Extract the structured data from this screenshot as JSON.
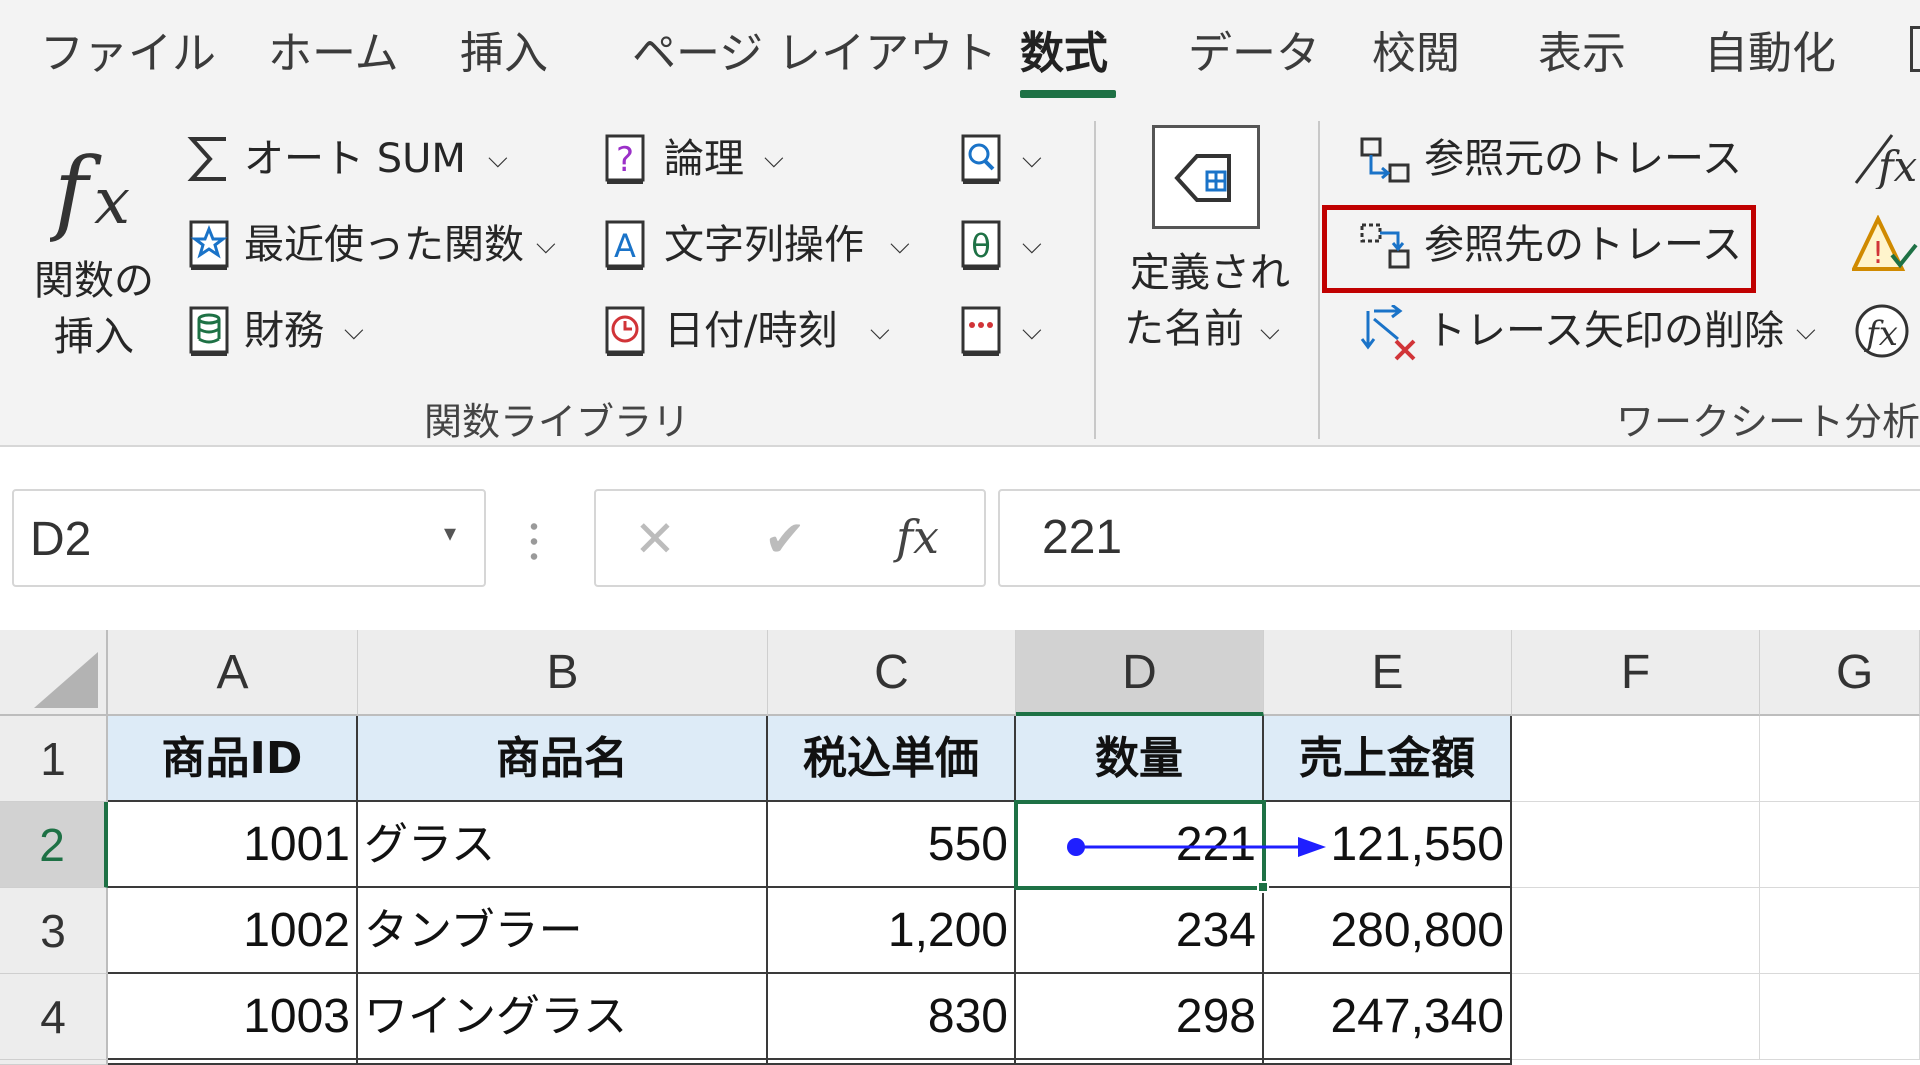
{
  "tabs": [
    {
      "label": "ファイル"
    },
    {
      "label": "ホーム"
    },
    {
      "label": "挿入"
    },
    {
      "label": "ページ レイアウト"
    },
    {
      "label": "数式"
    },
    {
      "label": "データ"
    },
    {
      "label": "校閲"
    },
    {
      "label": "表示"
    },
    {
      "label": "自動化"
    }
  ],
  "active_tab": "数式",
  "ribbon": {
    "insert_function": {
      "line1": "関数の",
      "line2": "挿入",
      "icon": "fx-icon"
    },
    "autosum": "オート SUM",
    "recent": "最近使った関数",
    "financial": "財務",
    "logical": "論理",
    "text": "文字列操作",
    "datetime": "日付/時刻",
    "defined_names": {
      "line1": "定義され",
      "line2": "た名前"
    },
    "trace_precedents": "参照元のトレース",
    "trace_dependents": "参照先のトレース",
    "remove_arrows": "トレース矢印の削除",
    "group_function_library": "関数ライブラリ",
    "group_formula_auditing": "ワークシート分析",
    "highlight_color": "#c00000"
  },
  "formula_bar": {
    "name_box": "D2",
    "formula": "221",
    "cancel_symbol": "✕",
    "enter_symbol": "✔",
    "fx_symbol": "fx"
  },
  "grid": {
    "columns": [
      "A",
      "B",
      "C",
      "D",
      "E",
      "F",
      "G"
    ],
    "rows": [
      "1",
      "2",
      "3",
      "4"
    ],
    "selected_cell": "D2",
    "header_fill": "#ddebf7",
    "selection_color": "#1e7145",
    "trace_arrow_color": "#1f1fff",
    "table": {
      "headers": [
        "商品ID",
        "商品名",
        "税込単価",
        "数量",
        "売上金額"
      ],
      "rows": [
        [
          "1001",
          "グラス",
          "550",
          "221",
          "121,550"
        ],
        [
          "1002",
          "タンブラー",
          "1,200",
          "234",
          "280,800"
        ],
        [
          "1003",
          "ワイングラス",
          "830",
          "298",
          "247,340"
        ]
      ]
    }
  }
}
